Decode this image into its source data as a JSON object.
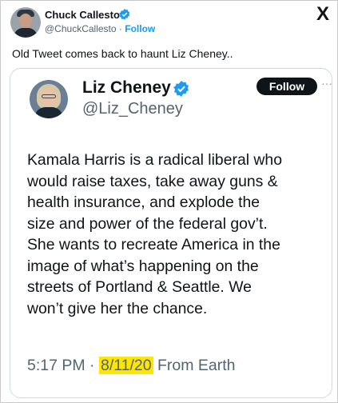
{
  "outer_tweet": {
    "author_name": "Chuck Callesto",
    "handle": "@ChuckCallesto",
    "separator": " · ",
    "follow_label": "Follow",
    "text": "Old Tweet comes back to haunt Liz Cheney..",
    "x_logo": "X"
  },
  "embedded_tweet": {
    "author_name": "Liz Cheney",
    "handle": "@Liz_Cheney",
    "follow_label": "Follow",
    "more_label": "···",
    "body_lines": [
      "Kamala Harris is a radical liberal who",
      "would raise taxes, take away guns &",
      "health insurance, and explode the",
      "size and power of the federal gov’t.",
      "She wants to recreate America in the",
      "image of what’s happening on the",
      "streets of Portland & Seattle. We",
      "won’t give her the chance."
    ],
    "time": "5:17 PM",
    "dot": " · ",
    "date": "8/11/20",
    "source": " From Earth"
  },
  "colors": {
    "verified_blue": "#1d9bf0",
    "date_highlight": "#ffe600",
    "follow_button_bg": "#0f1419"
  },
  "icons": {
    "verified": "verified-badge-icon",
    "x_logo": "x-logo-icon",
    "more": "more-options-icon"
  }
}
